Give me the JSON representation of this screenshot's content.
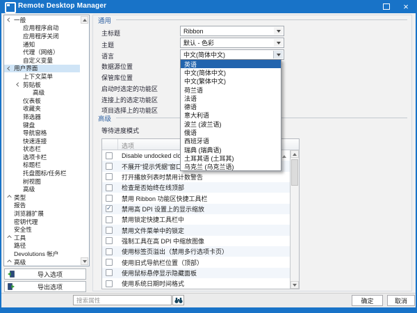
{
  "colors": {
    "titlebar": "#1873c8",
    "selection_blue": "#2264ae",
    "tree_selection": "#cfe4f6",
    "section_header_blue": "#3465a4",
    "alt_row": "#f2f6fb"
  },
  "icons": {
    "app": "app-logo-square",
    "maximize": "square-outline",
    "close": "×",
    "chevron_expanded": "v",
    "chevron_collapsed": ">",
    "scroll_up": "▲",
    "scroll_down": "▼",
    "sort_asc": "▲",
    "combo_arrow": "▾",
    "checkbox_check": "✓",
    "search": "binoculars",
    "import": "import-box",
    "export": "export-box"
  },
  "window": {
    "title": "Remote Desktop Manager"
  },
  "sidebar": {
    "items": [
      {
        "label": "一般",
        "level": 1,
        "arrow": "expanded"
      },
      {
        "label": "应用程序启动",
        "level": 2
      },
      {
        "label": "应用程序关闭",
        "level": 2
      },
      {
        "label": "通知",
        "level": 2
      },
      {
        "label": "代理（网络）",
        "level": 2
      },
      {
        "label": "自定义变量",
        "level": 2
      },
      {
        "label": "用户界面",
        "level": 1,
        "arrow": "expanded",
        "selected": true
      },
      {
        "label": "上下文菜单",
        "level": 2
      },
      {
        "label": "剪贴板",
        "level": 2,
        "arrow": "expanded"
      },
      {
        "label": "高级",
        "level": 3
      },
      {
        "label": "仪表板",
        "level": 2
      },
      {
        "label": "收藏夹",
        "level": 2
      },
      {
        "label": "筛选器",
        "level": 2
      },
      {
        "label": "键盘",
        "level": 2
      },
      {
        "label": "导航窗格",
        "level": 2
      },
      {
        "label": "快速连接",
        "level": 2
      },
      {
        "label": "状态栏",
        "level": 2
      },
      {
        "label": "选项卡栏",
        "level": 2
      },
      {
        "label": "标题栏",
        "level": 2
      },
      {
        "label": "托盘图标/任务栏",
        "level": 2
      },
      {
        "label": "树视图",
        "level": 2
      },
      {
        "label": "高级",
        "level": 2
      },
      {
        "label": "类型",
        "level": 1,
        "arrow": "collapsed"
      },
      {
        "label": "报告",
        "level": 1
      },
      {
        "label": "浏览器扩展",
        "level": 1
      },
      {
        "label": "密钥代理",
        "level": 1
      },
      {
        "label": "安全性",
        "level": 1
      },
      {
        "label": "工具",
        "level": 1,
        "arrow": "collapsed"
      },
      {
        "label": "路径",
        "level": 1
      },
      {
        "label": "Devolutions 帐户",
        "level": 1
      },
      {
        "label": "高级",
        "level": 1,
        "arrow": "collapsed"
      }
    ],
    "import_label": "导入选项",
    "export_label": "导出选项"
  },
  "main": {
    "section_general": "通用",
    "fields": [
      {
        "label": "主标题",
        "value": "Ribbon"
      },
      {
        "label": "主题",
        "value": "默认 - 色彩"
      },
      {
        "label": "语言",
        "value": "中文(简体中文)",
        "open": true
      },
      {
        "label": "数据源位置"
      },
      {
        "label": "保管库位置"
      },
      {
        "label": "启动时选定的功能区"
      },
      {
        "label": "连接上的选定功能区"
      },
      {
        "label": "项目选择上的功能区"
      }
    ],
    "language_dropdown": {
      "selected_index": 0,
      "items": [
        "英语",
        "中文(简体中文)",
        "中文(繁体中文)",
        "荷兰语",
        "法语",
        "德语",
        "意大利语",
        "波兰 (波兰语)",
        "俄语",
        "西班牙语",
        "瑞典 (瑞典语)",
        "土耳其语 (土耳其)",
        "乌克兰 (乌克兰语)"
      ]
    },
    "section_advanced": "高级",
    "wait_mode_label": "等待进度模式",
    "options_table": {
      "header": "选项",
      "rows": [
        {
          "label": "Disable undocked close button",
          "checked": false
        },
        {
          "label": "不展开“提示凭据”窗口中的文件夹",
          "checked": false
        },
        {
          "label": "打开播放列表时禁用计数警告",
          "checked": false
        },
        {
          "label": "检查是否始终在线顶部",
          "checked": false
        },
        {
          "label": "禁用 Ribbon 功能区快捷工具栏",
          "checked": false
        },
        {
          "label": "禁用高 DPI 设置上的显示缩放",
          "checked": true
        },
        {
          "label": "禁用锁定快捷工具栏中",
          "checked": false
        },
        {
          "label": "禁用文件菜单中的锁定",
          "checked": false
        },
        {
          "label": "强制工具在高 DPI 中缩放图像",
          "checked": false
        },
        {
          "label": "使用标签页溢出（禁用多行选项卡页）",
          "checked": false
        },
        {
          "label": "使用旧式导航栏位置（顶部）",
          "checked": false
        },
        {
          "label": "使用鼠标悬停显示隐藏面板",
          "checked": false
        },
        {
          "label": "使用系统日期时间格式",
          "checked": false
        }
      ]
    }
  },
  "footer": {
    "search_placeholder": "搜索属性",
    "ok_label": "确定",
    "cancel_label": "取消"
  }
}
